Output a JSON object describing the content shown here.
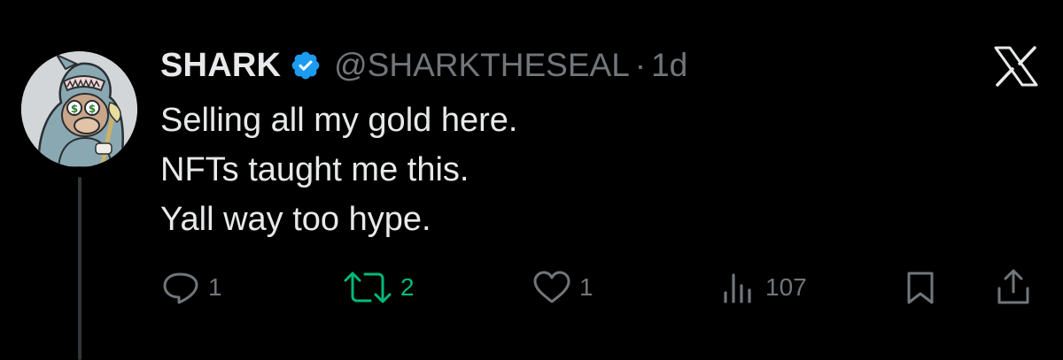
{
  "tweet": {
    "display_name": "SHARK",
    "handle": "@SHARKTHESEAL",
    "separator": "·",
    "time": "1d",
    "lines": [
      "Selling all my gold here.",
      "NFTs taught me this.",
      "Yall way too hype."
    ]
  },
  "actions": {
    "replies": "1",
    "reposts": "2",
    "likes": "1",
    "views": "107"
  },
  "colors": {
    "background": "#000000",
    "text": "#e7e9ea",
    "secondary": "#71767b",
    "verified": "#1d9bf0",
    "repost_active": "#00ba7c",
    "thread_line": "#333639"
  },
  "icons": {
    "verified": "verified-badge-icon",
    "close": "x-logo-icon",
    "reply": "reply-icon",
    "repost": "repost-icon",
    "like": "heart-icon",
    "views": "views-icon",
    "bookmark": "bookmark-icon",
    "share": "share-icon"
  }
}
